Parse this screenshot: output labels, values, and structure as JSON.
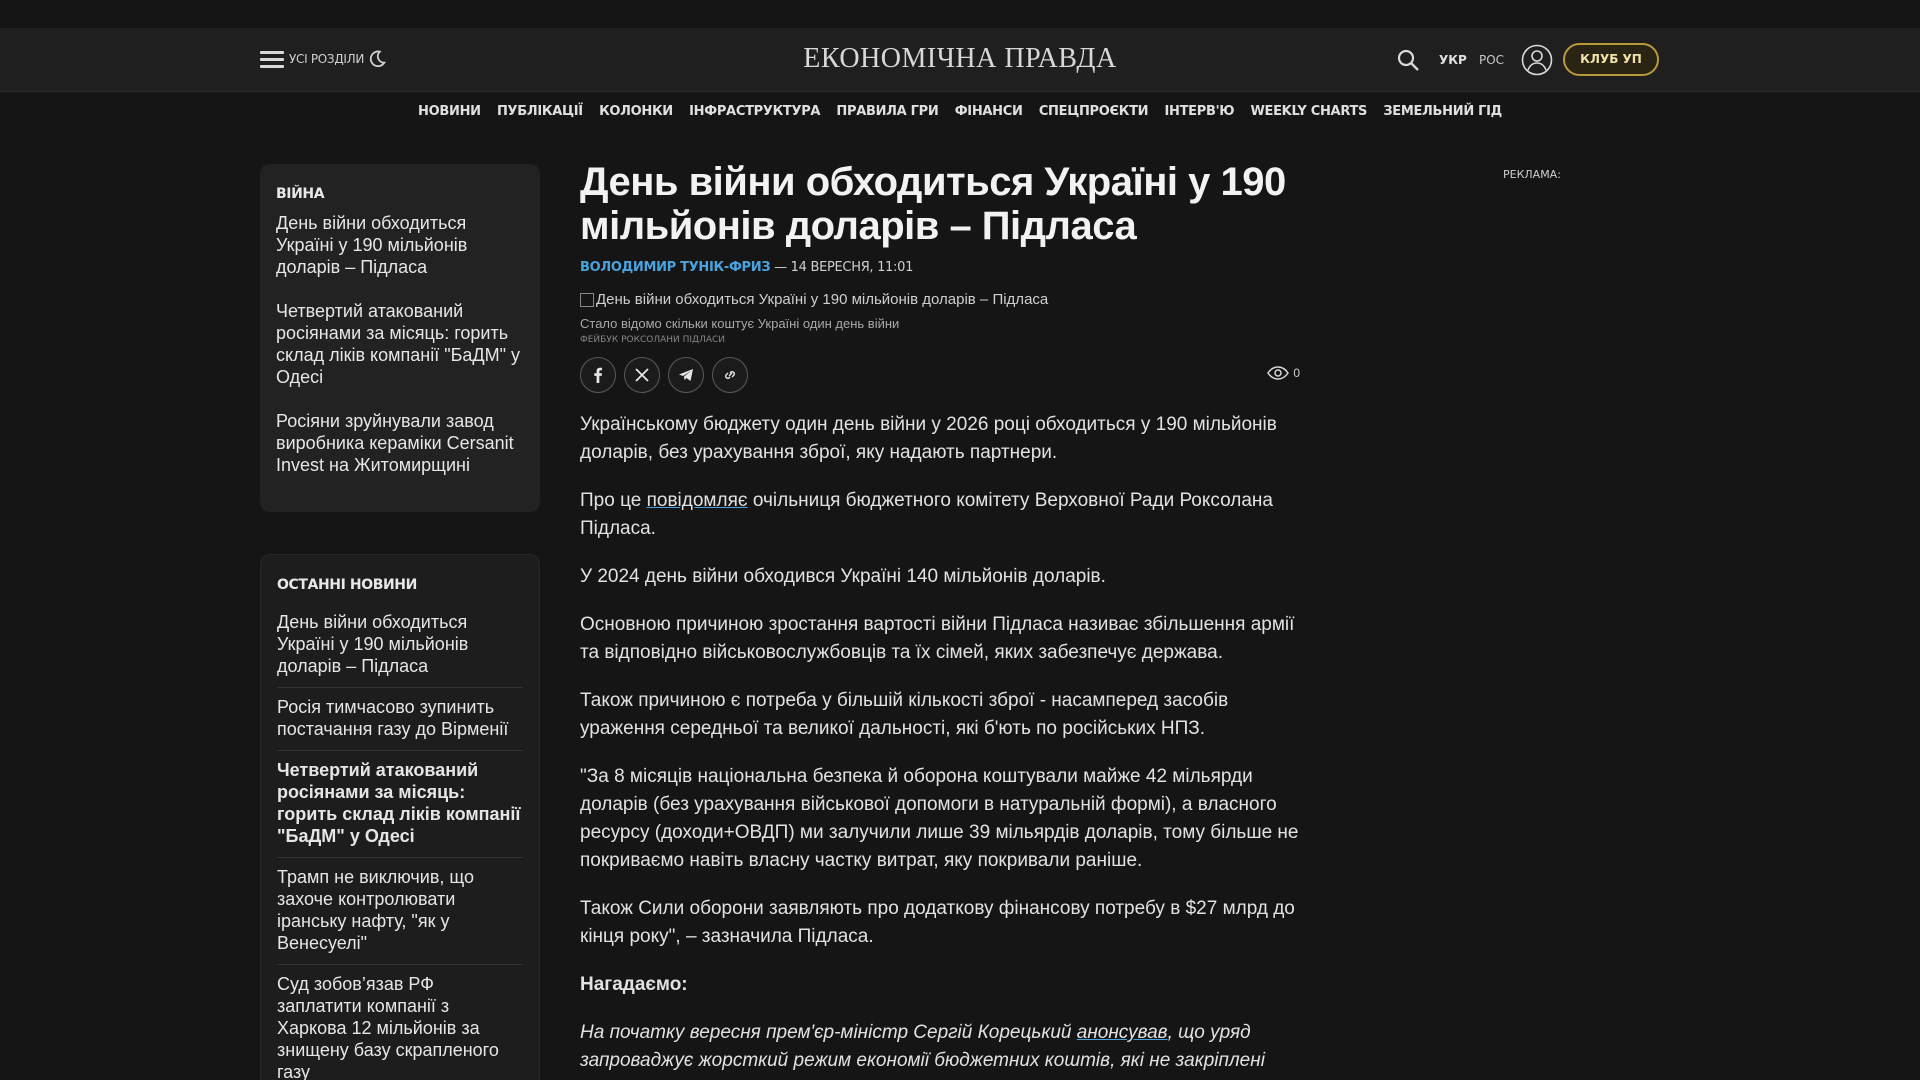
{
  "header": {
    "all_sections": "УСІ РОЗДІЛИ",
    "logo": "ЕКОНОМІЧНА ПРАВДА",
    "lang_ukr": "УКР",
    "lang_ros": "РОС",
    "club_button": "КЛУБ УП"
  },
  "nav": {
    "items": [
      "НОВИНИ",
      "ПУБЛІКАЦІЇ",
      "КОЛОНКИ",
      "ІНФРАСТРУКТУРА",
      "ПРАВИЛА ГРИ",
      "ФІНАНСИ",
      "СПЕЦПРОЄКТИ",
      "ІНТЕРВ'Ю",
      "WEEKLY CHARTS",
      "ЗЕМЕЛЬНИЙ ГІД"
    ]
  },
  "war_box": {
    "title": "ВІЙНА",
    "items": [
      "День війни обходиться Україні у 190 мільйонів доларів – Підласа",
      "Четвертий атакований росіянами за місяць: горить склад ліків компанії \"БаДМ\" у Одесі",
      "Росіяни зруйнували завод виробника кераміки Cersanit Invest на Житомирщині"
    ]
  },
  "latest_box": {
    "title": "ОСТАННІ НОВИНИ",
    "items": [
      "День війни обходиться Україні у 190 мільйонів доларів – Підласа",
      "Росія тимчасово зупинить постачання газу до Вірменії",
      "Четвертий атакований росіянами за місяць: горить склад ліків компанії \"БаДМ\" у Одесі",
      "Трамп не виключив, що захоче контролювати іранську нафту, \"як у Венесуелі\"",
      "Суд зобов’язав РФ заплатити компанії з Харкова 12 мільйонів за знищену базу скрапленого газу"
    ]
  },
  "article": {
    "title": "День війни обходиться Україні у 190 мільйонів доларів – Підласа",
    "author": "ВОЛОДИМИР ТУНІК-ФРИЗ",
    "date": " — 14 ВЕРЕСНЯ, 11:01",
    "image_alt": "День війни обходиться Україні у 190 мільйонів доларів – Підласа",
    "caption": "Стало відомо скільки коштує Україні один день війни",
    "credit": "ФЕЙБУК РОКСОЛАНИ ПІДЛАСИ",
    "views": "0",
    "p1": "Українському бюджету один день війни у 2026 році обходиться у 190 мільйонів доларів, без урахування зброї, яку надають партнери.",
    "p2_before": "Про це ",
    "p2_link": "повідомляє",
    "p2_after": " очільниця бюджетного комітету Верховної Ради Роксолана Підласа.",
    "p3": "У 2024 день війни обходився Україні 140 мільйонів доларів.",
    "p4": "Основною причиною зростання вартості війни Підласа називає збільшення армії та відповідно військовослужбовців та їх сімей, яких забезпечує держава.",
    "p5": "Також причиною є потреба у більшій кількості зброї - насамперед засобів ураження середньої та великої дальності, які б'ють по російських НПЗ.",
    "p6": "\"За 8 місяців національна безпека й оборона коштували майже 42 мільярди доларів (без урахування військової допомоги в натуральній формі), а власного ресурсу (доходи+ОВДП) ми залучили лише 39 мільярдів доларів, тому більше не покриваємо навіть власну частку витрат, яку покривали раніше.",
    "p7": "Також Сили оборони заявляють про додаткову фінансову потребу в $27 млрд до кінця року\", – зазначила Підласа.",
    "remind": "Нагадаємо:",
    "p8_before": "На початку вересня прем'єр-міністр Сергій Корецький ",
    "p8_link": "анонсував",
    "p8_after": ", що уряд запроваджує жорсткий режим економії бюджетних коштів, які не закріплені"
  },
  "ad_label": "РЕКЛАМА:"
}
